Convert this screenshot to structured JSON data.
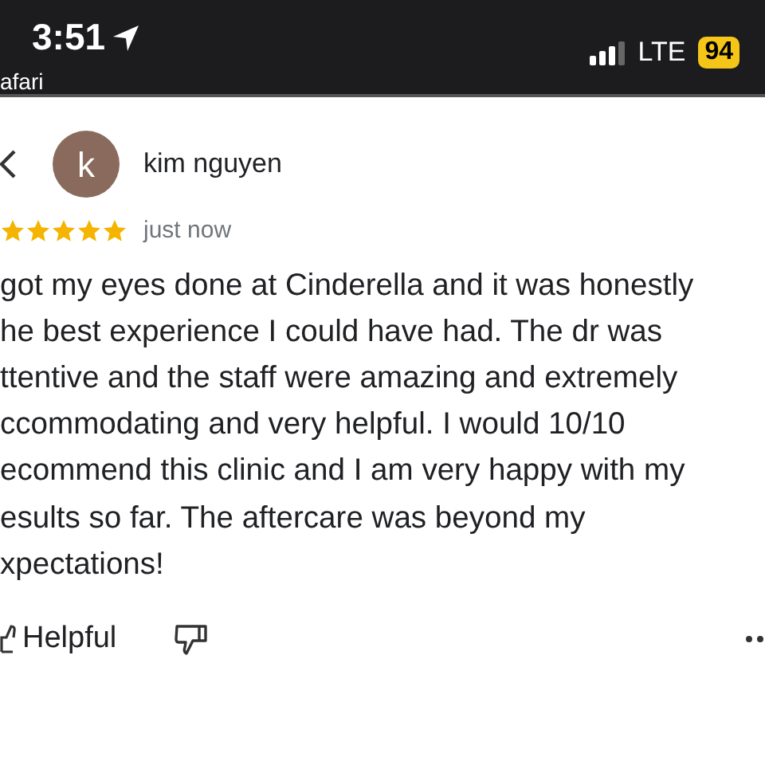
{
  "status_bar": {
    "time": "3:51",
    "back_app": "afari",
    "network": "LTE",
    "battery": "94"
  },
  "review": {
    "avatar_letter": "k",
    "author": "kim nguyen",
    "stars": 5,
    "time": "just now",
    "text_lines": [
      "got my eyes done at Cinderella and it was honestly",
      "he best experience I could have had. The dr was",
      "ttentive and the staff were amazing and extremely",
      "ccommodating and very helpful. I would 10/10",
      "ecommend this clinic and I am very happy with my",
      "esults so far. The aftercare was beyond my",
      "xpectations!"
    ],
    "helpful_label": "Helpful"
  }
}
